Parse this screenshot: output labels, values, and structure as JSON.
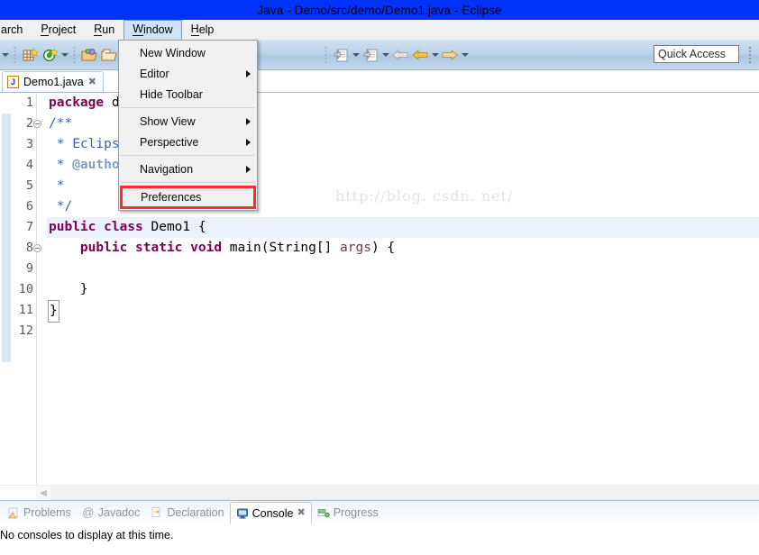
{
  "window": {
    "title": "Java - Demo/src/demo/Demo1.java - Eclipse"
  },
  "menubar": {
    "items": [
      {
        "label": "arch",
        "mnemonic": "",
        "active": false
      },
      {
        "label": "Project",
        "mnemonic": "P",
        "active": false
      },
      {
        "label": "Run",
        "mnemonic": "R",
        "active": false
      },
      {
        "label": "Window",
        "mnemonic": "W",
        "active": true
      },
      {
        "label": "Help",
        "mnemonic": "H",
        "active": false
      }
    ]
  },
  "toolbar": {
    "quick_access_placeholder": "Quick Access",
    "icons": [
      "new-wizard-icon",
      "new-java-class-icon",
      "open-type-icon",
      "open-resource-icon",
      "save-icon",
      "back-icon",
      "forward-prev-icon",
      "forward-icon"
    ]
  },
  "editor": {
    "tab": {
      "label": "Demo1.java",
      "close_glyph": "✖",
      "icon_letter": "J"
    },
    "watermark": "http://blog. csdn. net/",
    "lines": [
      {
        "n": 1,
        "fold": false,
        "hl": false,
        "text": "package demo;"
      },
      {
        "n": 2,
        "fold": true,
        "hl": false,
        "text": "/**"
      },
      {
        "n": 3,
        "fold": false,
        "hl": false,
        "text": " * Eclipse"
      },
      {
        "n": 4,
        "fold": false,
        "hl": false,
        "text": " * @author"
      },
      {
        "n": 5,
        "fold": false,
        "hl": false,
        "text": " *"
      },
      {
        "n": 6,
        "fold": false,
        "hl": false,
        "text": " */"
      },
      {
        "n": 7,
        "fold": false,
        "hl": true,
        "text": "public class Demo1 {"
      },
      {
        "n": 8,
        "fold": true,
        "hl": false,
        "text": "    public static void main(String[] args) {"
      },
      {
        "n": 9,
        "fold": false,
        "hl": false,
        "text": ""
      },
      {
        "n": 10,
        "fold": false,
        "hl": false,
        "text": "    }"
      },
      {
        "n": 11,
        "fold": false,
        "hl": false,
        "text": "}"
      },
      {
        "n": 12,
        "fold": false,
        "hl": false,
        "text": ""
      }
    ]
  },
  "window_menu": {
    "items": [
      {
        "label": "New Window",
        "submenu": false,
        "highlighted": false,
        "separator_after": false
      },
      {
        "label": "Editor",
        "submenu": true,
        "highlighted": false,
        "separator_after": false
      },
      {
        "label": "Hide Toolbar",
        "submenu": false,
        "highlighted": false,
        "separator_after": true
      },
      {
        "label": "Show View",
        "submenu": true,
        "highlighted": false,
        "separator_after": false
      },
      {
        "label": "Perspective",
        "submenu": true,
        "highlighted": false,
        "separator_after": true
      },
      {
        "label": "Navigation",
        "submenu": true,
        "highlighted": false,
        "separator_after": true
      },
      {
        "label": "Preferences",
        "submenu": false,
        "highlighted": true,
        "separator_after": false
      }
    ]
  },
  "bottom_panel": {
    "tabs": [
      {
        "label": "Problems",
        "icon": "problems-icon",
        "active": false,
        "closable": false
      },
      {
        "label": "Javadoc",
        "icon": "javadoc-icon",
        "active": false,
        "closable": false
      },
      {
        "label": "Declaration",
        "icon": "declaration-icon",
        "active": false,
        "closable": false
      },
      {
        "label": "Console",
        "icon": "console-icon",
        "active": true,
        "closable": true
      },
      {
        "label": "Progress",
        "icon": "progress-icon",
        "active": false,
        "closable": false
      }
    ],
    "message": "No consoles to display at this time."
  },
  "colors": {
    "title_bar": "#0033fa",
    "highlight_box": "#fb2c2c",
    "menu_active_bg": "#cfe3f7",
    "line_highlight": "#e8f1fc",
    "keyword": "#7f0055",
    "javadoc": "#3f5fbf"
  }
}
